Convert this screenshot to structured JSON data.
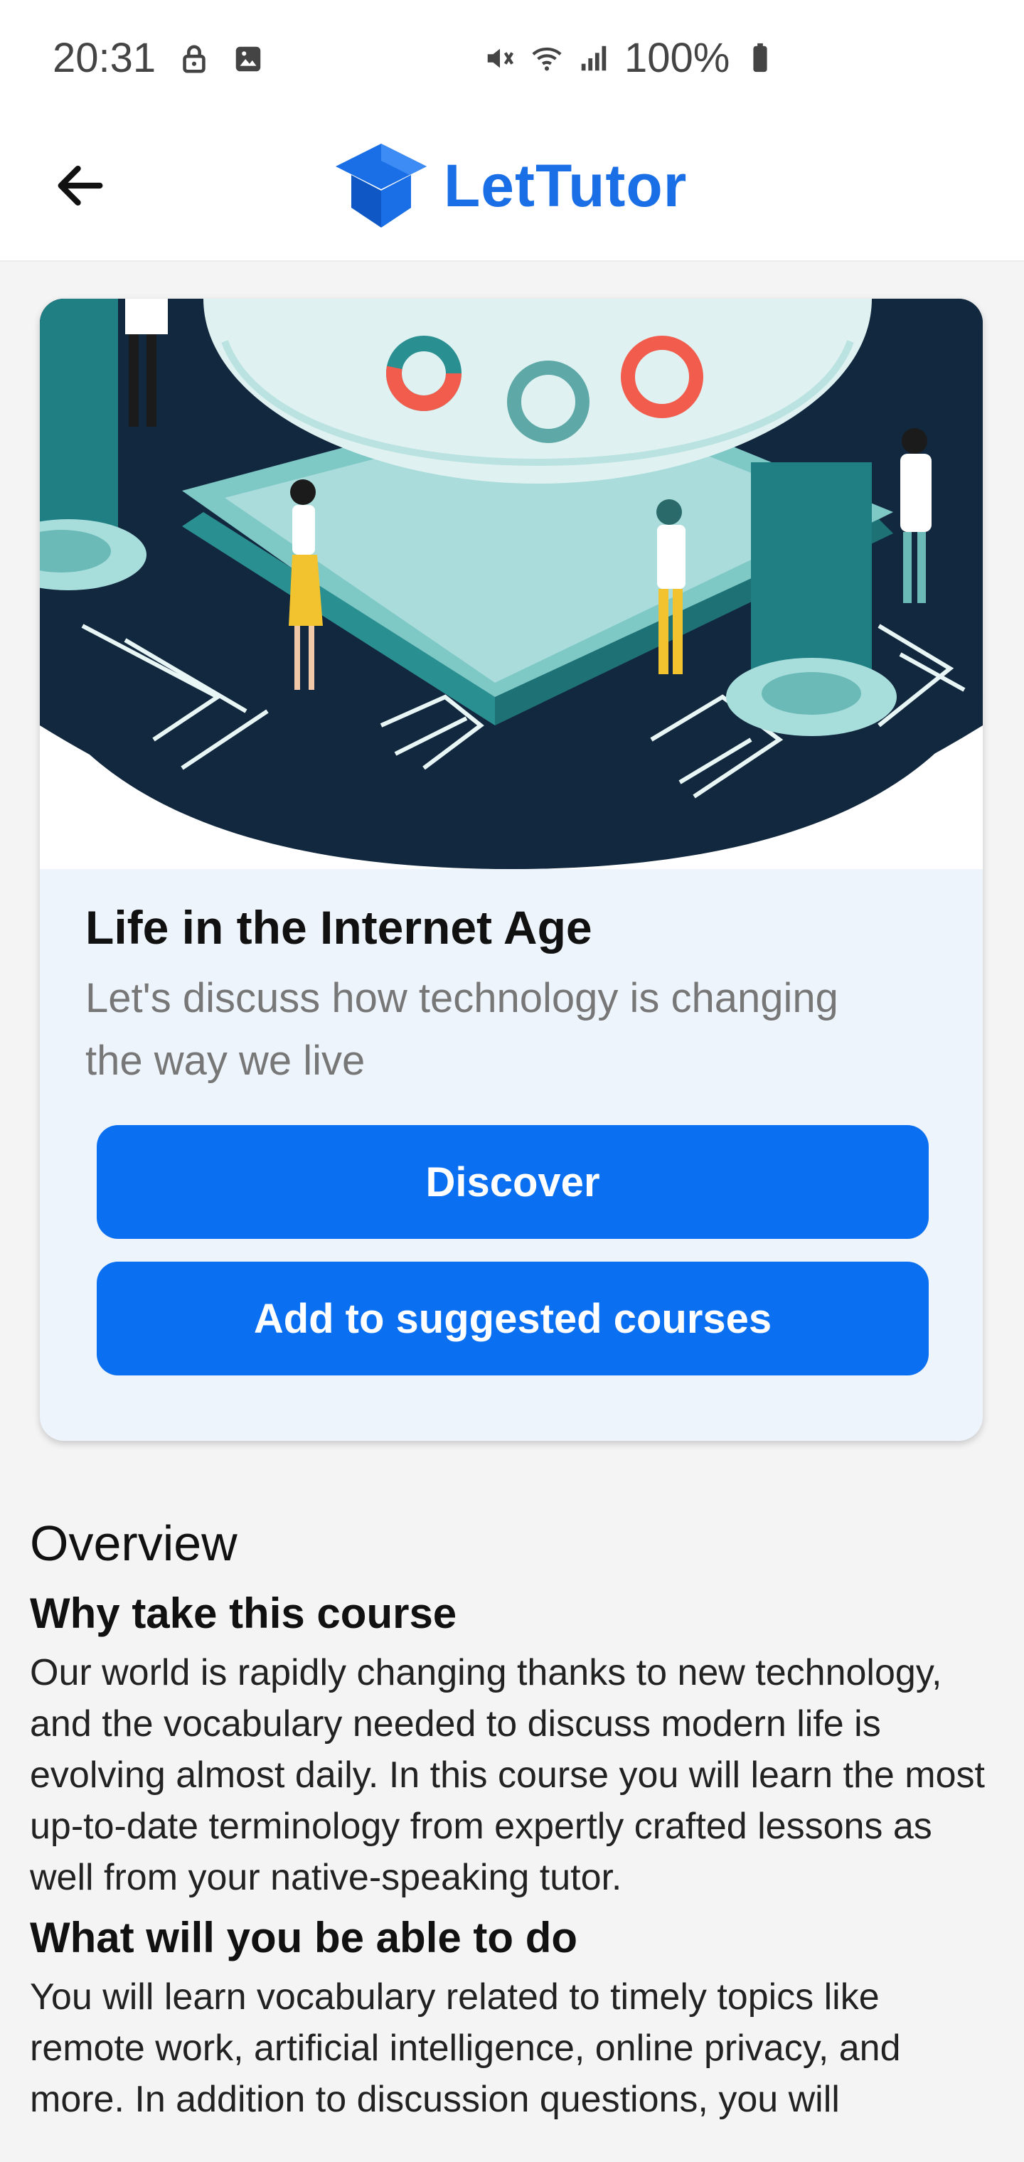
{
  "status_bar": {
    "time": "20:31",
    "battery_text": "100%",
    "icons": [
      "lock-icon",
      "image-icon",
      "mute-icon",
      "wifi-icon",
      "signal-icon",
      "battery-icon"
    ]
  },
  "app_bar": {
    "logo_text": "LetTutor",
    "back_icon": "arrow-left-icon",
    "brand_color": "#1a6fe6"
  },
  "course": {
    "title": "Life in the Internet Age",
    "description": "Let's discuss how technology is changing the way we live",
    "discover_label": "Discover",
    "suggest_label": "Add to suggested courses",
    "button_color": "#0a6ff0"
  },
  "overview": {
    "heading": "Overview",
    "why_title": "Why take this course",
    "why_text": "Our world is rapidly changing thanks to new technology, and the vocabulary needed to discuss modern life is evolving almost daily. In this course you will learn the most up-to-date terminology from expertly crafted lessons as well from your native-speaking tutor.",
    "able_title": "What will you be able to do",
    "able_text": "You will learn vocabulary related to timely topics like remote work, artificial intelligence, online privacy, and more. In addition to discussion questions, you will"
  }
}
